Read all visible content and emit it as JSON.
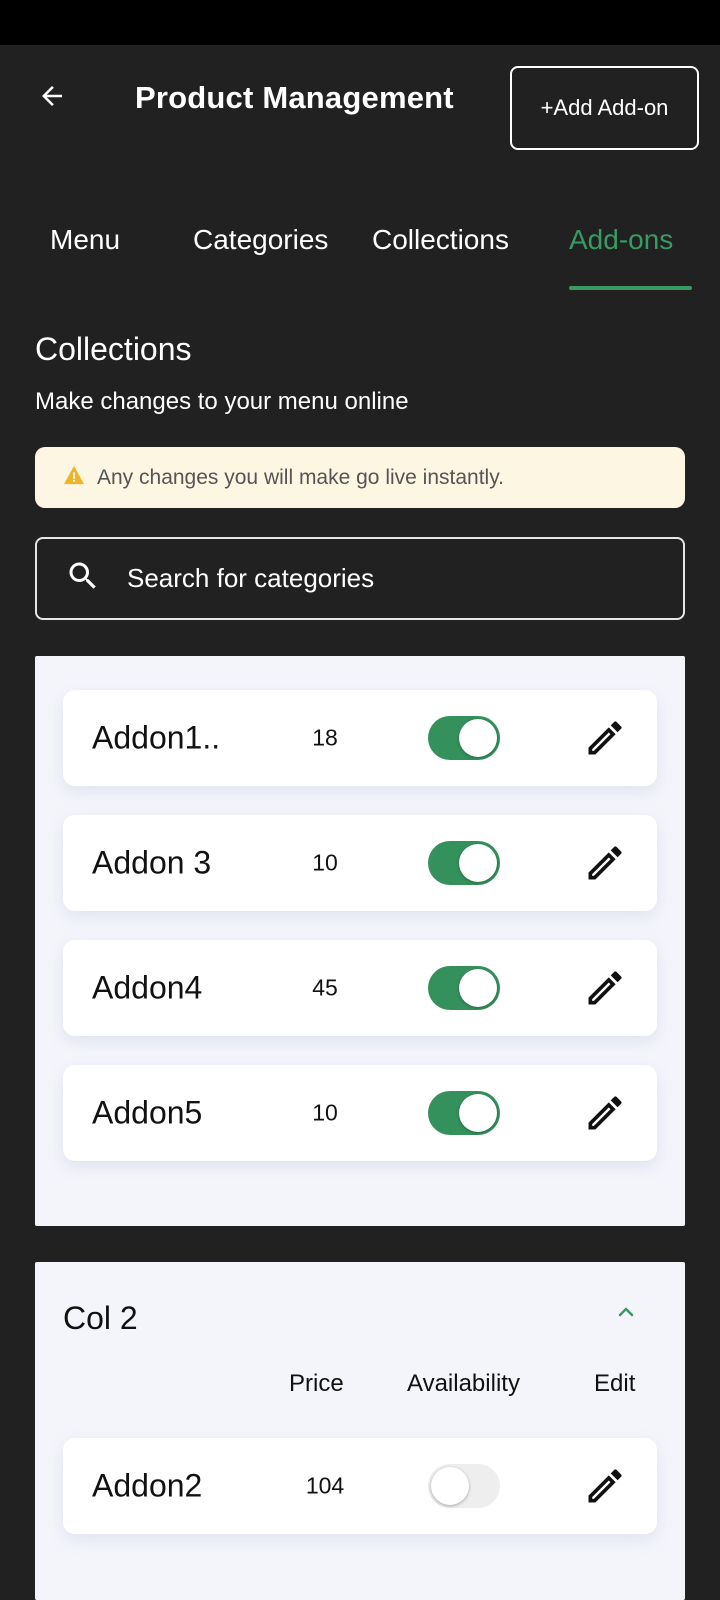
{
  "header": {
    "title": "Product Management",
    "add_button_label": "+Add Add-on"
  },
  "tabs": [
    {
      "label": "Menu",
      "active": false
    },
    {
      "label": "Categories",
      "active": false
    },
    {
      "label": "Collections",
      "active": false
    },
    {
      "label": "Add-ons",
      "active": true
    }
  ],
  "section": {
    "title": "Collections",
    "subtitle": "Make changes to your menu online"
  },
  "notice": {
    "icon": "warning-icon",
    "text": "Any changes you will make go live instantly."
  },
  "search": {
    "placeholder": "Search for categories",
    "value": ""
  },
  "collections": [
    {
      "title": "",
      "rows": [
        {
          "name": "Addon1..",
          "price": "18",
          "available": true
        },
        {
          "name": "Addon 3",
          "price": "10",
          "available": true
        },
        {
          "name": "Addon4",
          "price": "45",
          "available": true
        },
        {
          "name": "Addon5",
          "price": "10",
          "available": true
        }
      ]
    },
    {
      "title": "Col 2",
      "expanded": true,
      "columns": {
        "price": "Price",
        "availability": "Availability",
        "edit": "Edit"
      },
      "rows": [
        {
          "name": "Addon2",
          "price": "104",
          "available": false
        }
      ]
    }
  ],
  "colors": {
    "background": "#212121",
    "accent": "#3a9a64",
    "toggle_on": "#34915c",
    "notice_bg": "#fdf6e3",
    "panel_bg": "#f4f5fb"
  }
}
